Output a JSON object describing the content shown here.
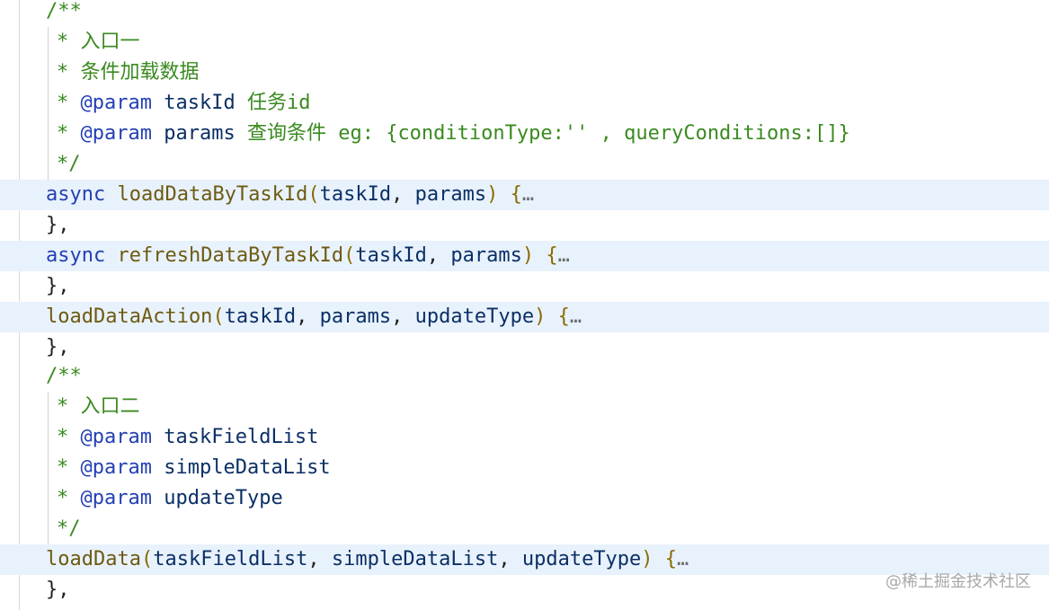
{
  "editor": {
    "lines": {
      "l1": {
        "text": "/**"
      },
      "l2": {
        "star": "*",
        "text": "入口一"
      },
      "l3": {
        "star": "*",
        "text": "条件加载数据"
      },
      "l4": {
        "star": "*",
        "tag": "@param",
        "name": "taskId",
        "desc": "任务id"
      },
      "l5": {
        "star": "*",
        "tag": "@param",
        "name": "params",
        "desc": "查询条件 eg: {conditionType:'' , queryConditions:[]}"
      },
      "l6": {
        "text": "*/"
      },
      "l7": {
        "kw": "async",
        "fn": "loadDataByTaskId",
        "open": "(",
        "p1": "taskId",
        "sep1": ", ",
        "p2": "params",
        "close": ")",
        "brace": " {",
        "ellipsis": "…"
      },
      "l8": {
        "text": "},"
      },
      "l9": {
        "kw": "async",
        "fn": "refreshDataByTaskId",
        "open": "(",
        "p1": "taskId",
        "sep1": ", ",
        "p2": "params",
        "close": ")",
        "brace": " {",
        "ellipsis": "…"
      },
      "l10": {
        "text": "},"
      },
      "l11": {
        "fn": "loadDataAction",
        "open": "(",
        "p1": "taskId",
        "sep1": ", ",
        "p2": "params",
        "sep2": ", ",
        "p3": "updateType",
        "close": ")",
        "brace": " {",
        "ellipsis": "…"
      },
      "l12": {
        "text": "},"
      },
      "l13": {
        "text": "/**"
      },
      "l14": {
        "star": "*",
        "text": "入口二"
      },
      "l15": {
        "star": "*",
        "tag": "@param",
        "name": "taskFieldList"
      },
      "l16": {
        "star": "*",
        "tag": "@param",
        "name": "simpleDataList"
      },
      "l17": {
        "star": "*",
        "tag": "@param",
        "name": "updateType"
      },
      "l18": {
        "text": "*/"
      },
      "l19": {
        "fn": "loadData",
        "open": "(",
        "p1": "taskFieldList",
        "sep1": ", ",
        "p2": "simpleDataList",
        "sep2": ", ",
        "p3": "updateType",
        "close": ")",
        "brace": " {",
        "ellipsis": "…"
      },
      "l20": {
        "text": "},"
      }
    }
  },
  "watermark": {
    "text": "@稀土掘金技术社区"
  },
  "colors": {
    "comment": "#3a8a1f",
    "keyword": "#2440b3",
    "function": "#6e5a12",
    "highlight": "#e8f2fc"
  }
}
